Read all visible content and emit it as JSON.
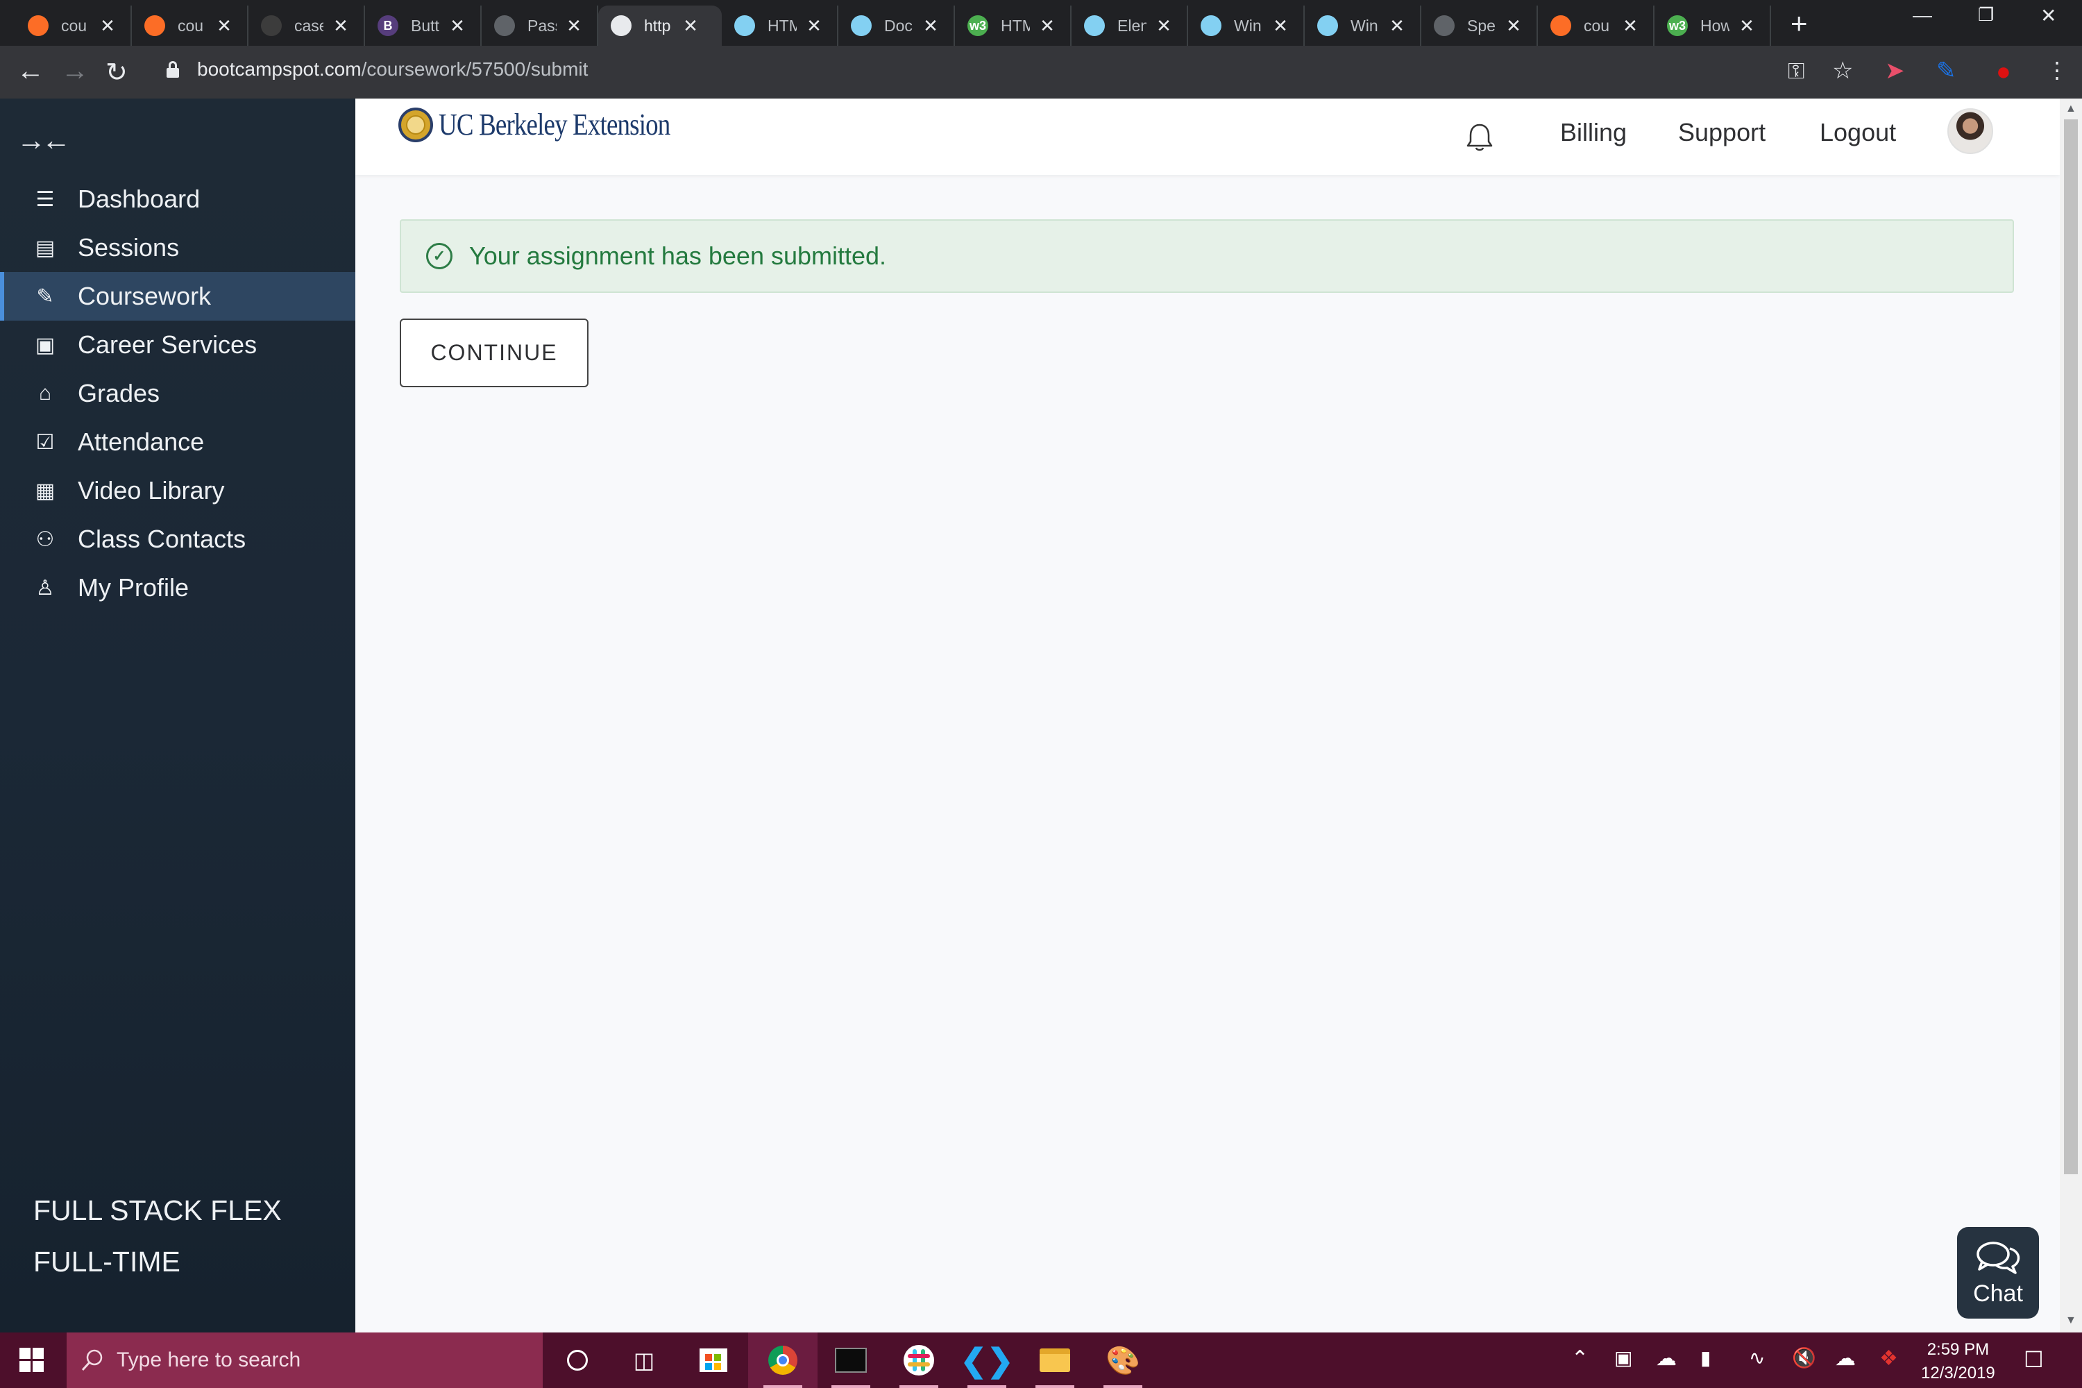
{
  "browser": {
    "tabs": [
      {
        "title": "cou",
        "favicon": "gitlab-icon",
        "color": "#fc6d26",
        "active": false
      },
      {
        "title": "cou",
        "favicon": "gitlab-icon",
        "color": "#fc6d26",
        "active": false
      },
      {
        "title": "case",
        "favicon": "github-icon",
        "color": "#3c3c3c",
        "active": false
      },
      {
        "title": "Butt",
        "favicon": "bootstrap-icon",
        "color": "#563d7c",
        "glyph": "B",
        "active": false
      },
      {
        "title": "Pass",
        "favicon": "globe-icon",
        "color": "#5f6368",
        "active": false
      },
      {
        "title": "http",
        "favicon": "globe-icon",
        "color": "#e8eaed",
        "active": true
      },
      {
        "title": "HTM",
        "favicon": "mdn-icon",
        "color": "#83d0f2",
        "active": false
      },
      {
        "title": "Doc",
        "favicon": "mdn-icon",
        "color": "#83d0f2",
        "active": false
      },
      {
        "title": "HTM",
        "favicon": "w3schools-icon",
        "color": "#4caf50",
        "glyph": "w3",
        "active": false
      },
      {
        "title": "Elen",
        "favicon": "mdn-icon",
        "color": "#83d0f2",
        "active": false
      },
      {
        "title": "Win",
        "favicon": "mdn-icon",
        "color": "#83d0f2",
        "active": false
      },
      {
        "title": "Win",
        "favicon": "mdn-icon",
        "color": "#83d0f2",
        "active": false
      },
      {
        "title": "Spe",
        "favicon": "globe-icon",
        "color": "#5f6368",
        "active": false
      },
      {
        "title": "cou",
        "favicon": "gitlab-icon",
        "color": "#fc6d26",
        "active": false
      },
      {
        "title": "How",
        "favicon": "w3schools-icon",
        "color": "#4caf50",
        "glyph": "w3",
        "active": false
      }
    ],
    "url_host": "bootcampspot.com",
    "url_path": "/coursework/57500/submit"
  },
  "sidebar": {
    "items": [
      {
        "label": "Dashboard",
        "icon": "list-icon",
        "active": false
      },
      {
        "label": "Sessions",
        "icon": "sessions-icon",
        "active": false
      },
      {
        "label": "Coursework",
        "icon": "edit-icon",
        "active": true
      },
      {
        "label": "Career Services",
        "icon": "briefcase-icon",
        "active": false
      },
      {
        "label": "Grades",
        "icon": "graduation-cap-icon",
        "active": false
      },
      {
        "label": "Attendance",
        "icon": "calendar-check-icon",
        "active": false
      },
      {
        "label": "Video Library",
        "icon": "film-icon",
        "active": false
      },
      {
        "label": "Class Contacts",
        "icon": "users-icon",
        "active": false
      },
      {
        "label": "My Profile",
        "icon": "user-icon",
        "active": false
      }
    ],
    "program_line1": "FULL STACK FLEX",
    "program_line2": "FULL-TIME"
  },
  "header": {
    "logo_text": "UC Berkeley Extension",
    "billing": "Billing",
    "support": "Support",
    "logout": "Logout"
  },
  "main": {
    "alert_text": "Your assignment has been submitted.",
    "continue_label": "CONTINUE"
  },
  "chat": {
    "label": "Chat"
  },
  "taskbar": {
    "search_placeholder": "Type here to search",
    "time": "2:59 PM",
    "date": "12/3/2019"
  },
  "colors": {
    "sidebar_bg": "#1e2a36",
    "sidebar_active": "#2e4661",
    "alert_bg": "#e6f1e8",
    "alert_text": "#247a3f",
    "taskbar_bg": "#4d0f2b"
  }
}
